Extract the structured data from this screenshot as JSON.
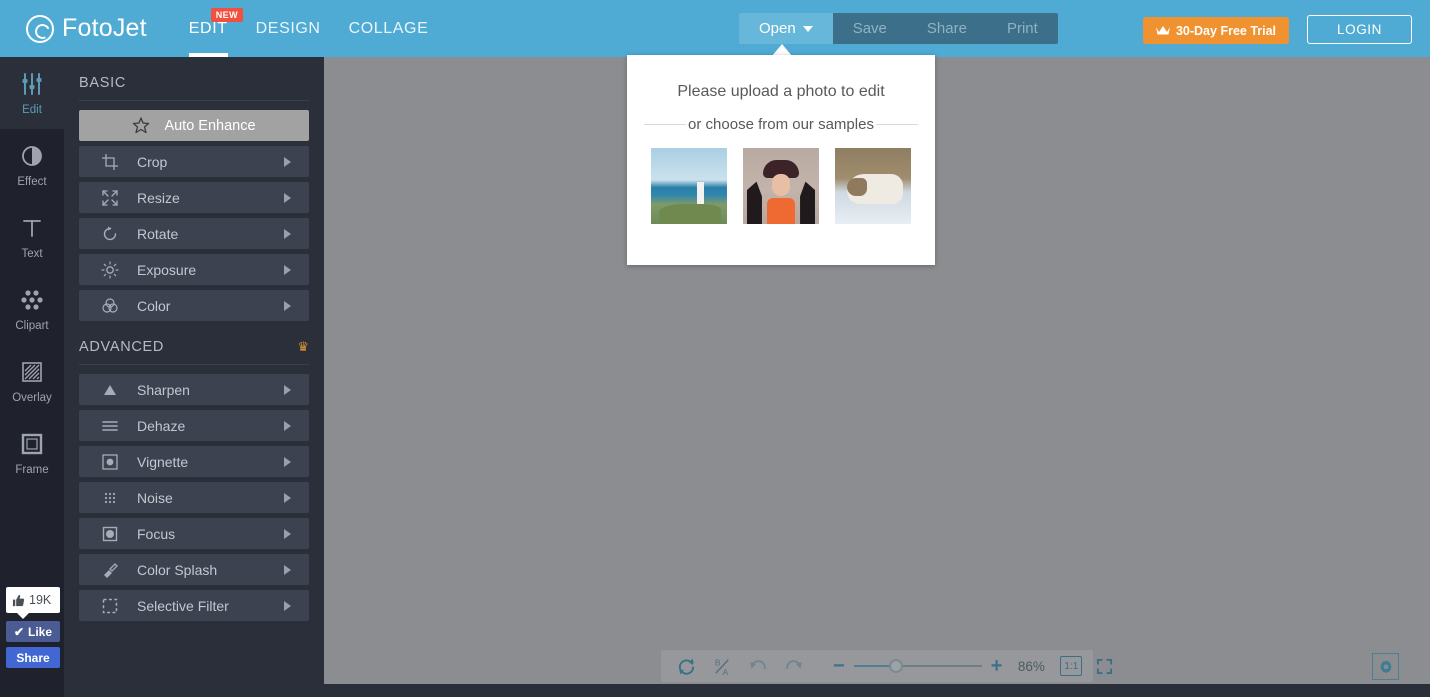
{
  "app": {
    "brand": "FotoJet"
  },
  "header": {
    "nav": [
      {
        "label": "EDIT",
        "badge": "NEW",
        "active": true
      },
      {
        "label": "DESIGN",
        "badge": "",
        "active": false
      },
      {
        "label": "COLLAGE",
        "badge": "",
        "active": false
      }
    ],
    "file_buttons": [
      {
        "label": "Open",
        "active": true,
        "has_caret": true
      },
      {
        "label": "Save",
        "active": false,
        "has_caret": false
      },
      {
        "label": "Share",
        "active": false,
        "has_caret": false
      },
      {
        "label": "Print",
        "active": false,
        "has_caret": false
      }
    ],
    "trial_label": "30-Day Free Trial",
    "login_label": "LOGIN",
    "colors": {
      "bar": "#4fabd4",
      "trial": "#f0922f",
      "badge": "#f1503e"
    }
  },
  "rail": {
    "items": [
      {
        "label": "Edit",
        "icon": "sliders-icon",
        "active": true
      },
      {
        "label": "Effect",
        "icon": "contrast-circle-icon",
        "active": false
      },
      {
        "label": "Text",
        "icon": "text-t-icon",
        "active": false
      },
      {
        "label": "Clipart",
        "icon": "dots-cluster-icon",
        "active": false
      },
      {
        "label": "Overlay",
        "icon": "hatched-square-icon",
        "active": false
      },
      {
        "label": "Frame",
        "icon": "frame-square-icon",
        "active": false
      }
    ]
  },
  "panel": {
    "basic": {
      "title": "BASIC",
      "tools": [
        {
          "label": "Auto Enhance",
          "icon": "magic-wand-icon",
          "highlight": true,
          "arrow": false
        },
        {
          "label": "Crop",
          "icon": "crop-icon",
          "highlight": false,
          "arrow": true
        },
        {
          "label": "Resize",
          "icon": "resize-arrows-icon",
          "highlight": false,
          "arrow": true
        },
        {
          "label": "Rotate",
          "icon": "rotate-ccw-icon",
          "highlight": false,
          "arrow": true
        },
        {
          "label": "Exposure",
          "icon": "sun-icon",
          "highlight": false,
          "arrow": true
        },
        {
          "label": "Color",
          "icon": "color-circles-icon",
          "highlight": false,
          "arrow": true
        }
      ]
    },
    "advanced": {
      "title": "ADVANCED",
      "crown": "♛",
      "tools": [
        {
          "label": "Sharpen",
          "icon": "triangle-icon",
          "highlight": false,
          "arrow": true
        },
        {
          "label": "Dehaze",
          "icon": "lines-icon",
          "highlight": false,
          "arrow": true
        },
        {
          "label": "Vignette",
          "icon": "vignette-icon",
          "highlight": false,
          "arrow": true
        },
        {
          "label": "Noise",
          "icon": "noise-dots-icon",
          "highlight": false,
          "arrow": true
        },
        {
          "label": "Focus",
          "icon": "focus-circle-icon",
          "highlight": false,
          "arrow": true
        },
        {
          "label": "Color Splash",
          "icon": "brush-icon",
          "highlight": false,
          "arrow": true
        },
        {
          "label": "Selective Filter",
          "icon": "dashed-square-icon",
          "highlight": false,
          "arrow": true
        }
      ]
    }
  },
  "popup": {
    "title": "Please upload a photo to edit",
    "subtitle": "or choose from our samples",
    "samples": [
      {
        "name": "lighthouse-coast-sample"
      },
      {
        "name": "woman-with-hat-sample"
      },
      {
        "name": "sleeping-cat-sample"
      }
    ]
  },
  "bottom_toolbar": {
    "buttons": [
      {
        "name": "reset-button",
        "icon": "refresh-icon"
      },
      {
        "name": "compare-button",
        "icon": "before-after-icon"
      },
      {
        "name": "undo-button",
        "icon": "undo-arrow-icon"
      },
      {
        "name": "redo-button",
        "icon": "redo-arrow-icon"
      }
    ],
    "zoom_out": "−",
    "zoom_in": "+",
    "zoom_level": "86%",
    "actual_size": "1:1",
    "fit_screen_icon": "expand-icon"
  },
  "settings": {
    "icon": "gear-icon"
  },
  "facebook_widget": {
    "count": "19K",
    "like_label": "Like",
    "share_label": "Share",
    "check": "✔",
    "thumb": "👍"
  }
}
